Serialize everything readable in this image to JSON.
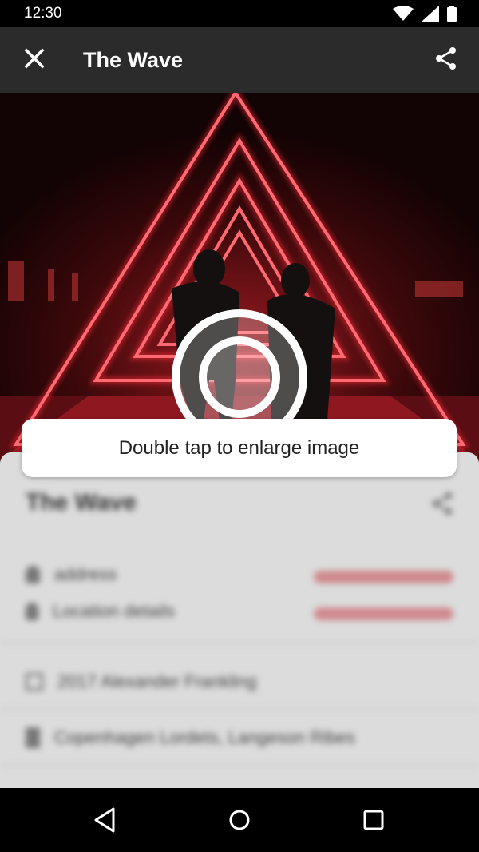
{
  "status_bar": {
    "time": "12:30"
  },
  "app_bar": {
    "title": "The Wave",
    "close_icon": "close-icon",
    "share_icon": "share-icon"
  },
  "toast": {
    "message": "Double tap to enlarge image"
  },
  "sheet": {
    "name": "The Wave",
    "rows": [
      {
        "icon": "person-icon",
        "label": "address"
      },
      {
        "icon": "pin-icon",
        "label": "Location details"
      },
      {
        "icon": "calendar-icon",
        "label": "2017 Alexander Frankling"
      },
      {
        "icon": "building-icon",
        "label": "Copenhagen Lordets, Langeson Ribes"
      }
    ]
  },
  "colors": {
    "neon": "#ff2f3a",
    "appbar": "#2b2b2b",
    "sheet": "#dcdcdc"
  },
  "navigation_bar": {
    "back_icon": "back-icon",
    "home_icon": "home-icon",
    "recents_icon": "recents-icon"
  }
}
